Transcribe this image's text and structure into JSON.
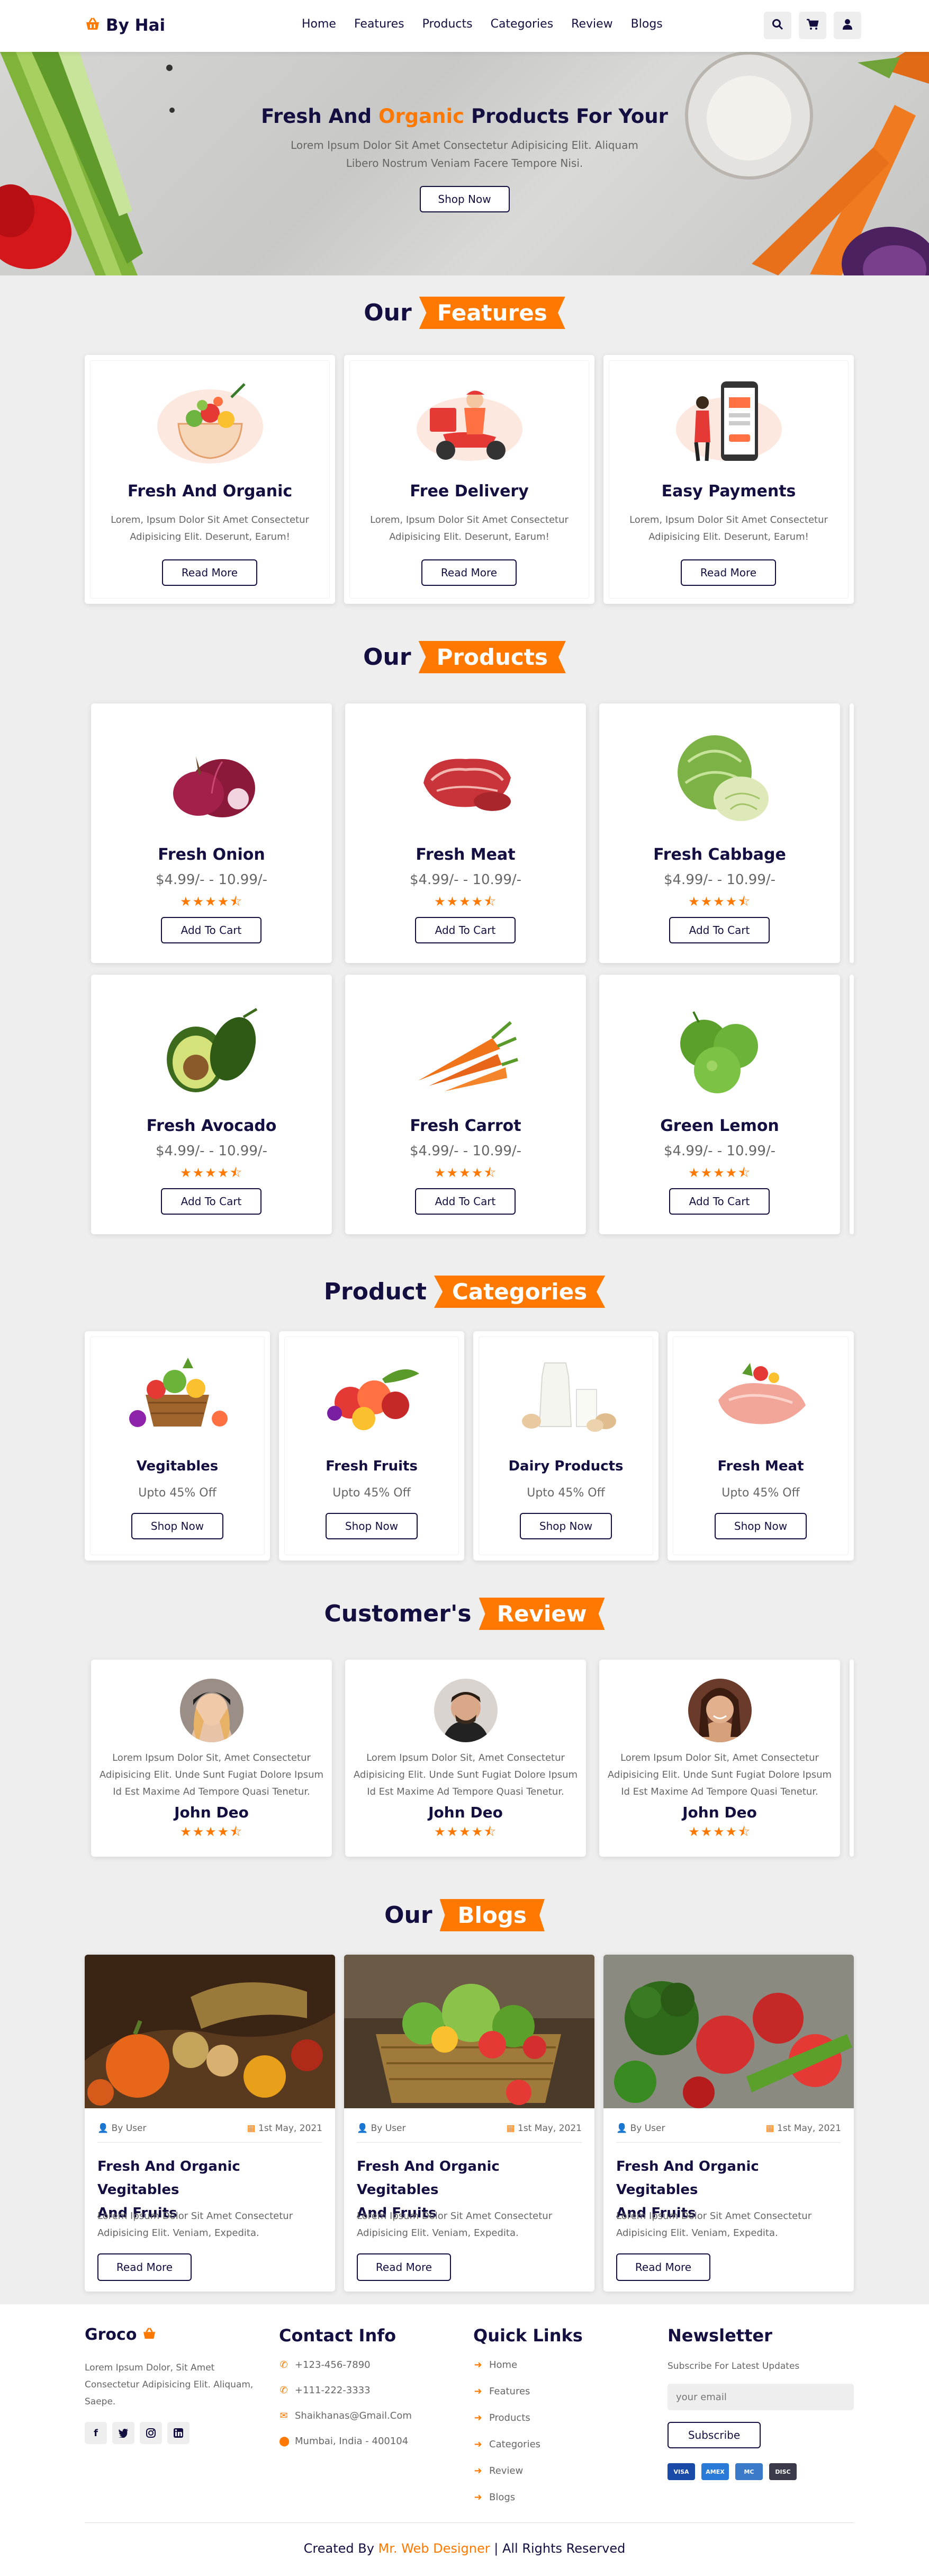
{
  "header": {
    "logo": "By Hai",
    "nav": [
      "Home",
      "Features",
      "Products",
      "Categories",
      "Review",
      "Blogs"
    ],
    "icons": [
      "search-icon",
      "cart-icon",
      "user-icon"
    ]
  },
  "hero": {
    "title_pre": "Fresh And ",
    "title_hl": "Organic",
    "title_post": " Products For Your",
    "text_line1": "Lorem Ipsum Dolor Sit Amet Consectetur Adipisicing Elit. Aliquam",
    "text_line2": "Libero Nostrum Veniam Facere Tempore Nisi.",
    "button": "Shop Now"
  },
  "features": {
    "heading": "Our",
    "tag": "Features",
    "items": [
      {
        "title": "Fresh And Organic",
        "text1": "Lorem, Ipsum Dolor Sit Amet Consectetur",
        "text2": "Adipisicing Elit. Deserunt, Earum!",
        "button": "Read More",
        "icon": "salad-icon"
      },
      {
        "title": "Free Delivery",
        "text1": "Lorem, Ipsum Dolor Sit Amet Consectetur",
        "text2": "Adipisicing Elit. Deserunt, Earum!",
        "button": "Read More",
        "icon": "delivery-scooter-icon"
      },
      {
        "title": "Easy Payments",
        "text1": "Lorem, Ipsum Dolor Sit Amet Consectetur",
        "text2": "Adipisicing Elit. Deserunt, Earum!",
        "button": "Read More",
        "icon": "mobile-payment-icon"
      }
    ]
  },
  "products": {
    "heading": "Our",
    "tag": "Products",
    "items": [
      {
        "name": "Fresh Onion",
        "price": "$4.99/- - 10.99/-",
        "stars": "★★★★⯪",
        "button": "Add To Cart"
      },
      {
        "name": "Fresh Meat",
        "price": "$4.99/- - 10.99/-",
        "stars": "★★★★⯪",
        "button": "Add To Cart"
      },
      {
        "name": "Fresh Cabbage",
        "price": "$4.99/- - 10.99/-",
        "stars": "★★★★⯪",
        "button": "Add To Cart"
      },
      {
        "name": "Fresh Avocado",
        "price": "$4.99/- - 10.99/-",
        "stars": "★★★★⯪",
        "button": "Add To Cart"
      },
      {
        "name": "Fresh Carrot",
        "price": "$4.99/- - 10.99/-",
        "stars": "★★★★⯪",
        "button": "Add To Cart"
      },
      {
        "name": "Green Lemon",
        "price": "$4.99/- - 10.99/-",
        "stars": "★★★★⯪",
        "button": "Add To Cart"
      }
    ]
  },
  "categories": {
    "heading": "Product",
    "tag": "Categories",
    "items": [
      {
        "name": "Vegitables",
        "discount": "Upto 45% Off",
        "button": "Shop Now"
      },
      {
        "name": "Fresh Fruits",
        "discount": "Upto 45% Off",
        "button": "Shop Now"
      },
      {
        "name": "Dairy Products",
        "discount": "Upto 45% Off",
        "button": "Shop Now"
      },
      {
        "name": "Fresh Meat",
        "discount": "Upto 45% Off",
        "button": "Shop Now"
      }
    ]
  },
  "reviews": {
    "heading": "Customer's",
    "tag": "Review",
    "items": [
      {
        "text1": "Lorem Ipsum Dolor Sit, Amet Consectetur",
        "text2": "Adipisicing Elit. Unde Sunt Fugiat Dolore Ipsum",
        "text3": "Id Est Maxime Ad Tempore Quasi Tenetur.",
        "name": "John Deo",
        "stars": "★★★★⯪"
      },
      {
        "text1": "Lorem Ipsum Dolor Sit, Amet Consectetur",
        "text2": "Adipisicing Elit. Unde Sunt Fugiat Dolore Ipsum",
        "text3": "Id Est Maxime Ad Tempore Quasi Tenetur.",
        "name": "John Deo",
        "stars": "★★★★⯪"
      },
      {
        "text1": "Lorem Ipsum Dolor Sit, Amet Consectetur",
        "text2": "Adipisicing Elit. Unde Sunt Fugiat Dolore Ipsum",
        "text3": "Id Est Maxime Ad Tempore Quasi Tenetur.",
        "name": "John Deo",
        "stars": "★★★★⯪"
      }
    ]
  },
  "blogs": {
    "heading": "Our",
    "tag": "Blogs",
    "items": [
      {
        "author": "By User",
        "date": "1st May, 2021",
        "title1": "Fresh And Organic Vegitables",
        "title2": "And Fruits",
        "text1": "Lorem Ipsum Dolor Sit Amet Consectetur",
        "text2": "Adipisicing Elit. Veniam, Expedita.",
        "button": "Read More"
      },
      {
        "author": "By User",
        "date": "1st May, 2021",
        "title1": "Fresh And Organic Vegitables",
        "title2": "And Fruits",
        "text1": "Lorem Ipsum Dolor Sit Amet Consectetur",
        "text2": "Adipisicing Elit. Veniam, Expedita.",
        "button": "Read More"
      },
      {
        "author": "By User",
        "date": "1st May, 2021",
        "title1": "Fresh And Organic Vegitables",
        "title2": "And Fruits",
        "text1": "Lorem Ipsum Dolor Sit Amet Consectetur",
        "text2": "Adipisicing Elit. Veniam, Expedita.",
        "button": "Read More"
      }
    ]
  },
  "footer": {
    "brand": "Groco",
    "about1": "Lorem Ipsum Dolor, Sit Amet",
    "about2": "Consectetur Adipisicing Elit. Aliquam,",
    "about3": "Saepe.",
    "social": [
      "facebook-icon",
      "twitter-icon",
      "instagram-icon",
      "linkedin-icon"
    ],
    "contact_heading": "Contact Info",
    "phone1": "+123-456-7890",
    "phone2": "+111-222-3333",
    "email": "Shaikhanas@Gmail.Com",
    "address": "Mumbai, India - 400104",
    "links_heading": "Quick Links",
    "links": [
      "Home",
      "Features",
      "Products",
      "Categories",
      "Review",
      "Blogs"
    ],
    "newsletter_heading": "Newsletter",
    "newsletter_text": "Subscribe For Latest Updates",
    "email_placeholder": "your email",
    "subscribe": "Subscribe",
    "payments": [
      "VISA",
      "AMEX",
      "MC",
      "DISC"
    ],
    "credit_pre": "Created By ",
    "credit_name": "Mr. Web Designer",
    "credit_post": " | All Rights Reserved"
  },
  "colors": {
    "accent": "#ff7800",
    "text": "#130f40",
    "muted": "#666666",
    "bg": "#eeeeee"
  }
}
